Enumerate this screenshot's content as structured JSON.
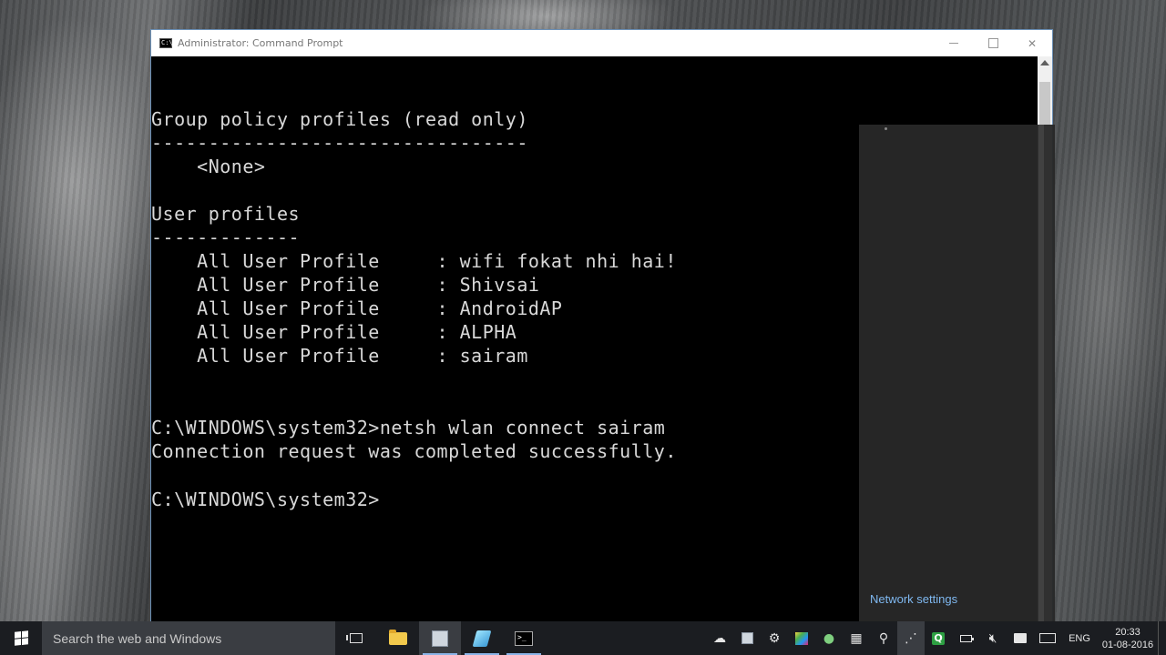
{
  "window": {
    "title": "Administrator: Command Prompt",
    "icon_text": "C:\\",
    "minimize": "minimize",
    "maximize": "maximize",
    "close": "✕"
  },
  "console": {
    "lines": [
      "Group policy profiles (read only)",
      "---------------------------------",
      "    <None>",
      "",
      "User profiles",
      "-------------",
      "    All User Profile     : wifi fokat nhi hai!",
      "    All User Profile     : Shivsai",
      "    All User Profile     : AndroidAP",
      "    All User Profile     : ALPHA",
      "    All User Profile     : sairam",
      "",
      "",
      "C:\\WINDOWS\\system32>netsh wlan connect sairam",
      "Connection request was completed successfully.",
      "",
      "C:\\WINDOWS\\system32>"
    ]
  },
  "flyout": {
    "network_settings": "Network settings"
  },
  "taskbar": {
    "search_placeholder": "Search the web and Windows",
    "language": "ENG",
    "time": "20:33",
    "date": "01-08-2016",
    "icons": [
      "task-view-icon",
      "file-explorer-icon",
      "app-icon",
      "pen-app-icon",
      "command-prompt-icon"
    ],
    "tray_icons": [
      "onedrive-icon",
      "app-tray-icon",
      "network-tool-icon",
      "colorful-app-icon",
      "chat-icon",
      "calculator-icon",
      "usb-icon",
      "wifi-icon",
      "q-app-icon",
      "battery-icon",
      "volume-muted-icon",
      "action-center-icon",
      "keyboard-icon"
    ]
  }
}
